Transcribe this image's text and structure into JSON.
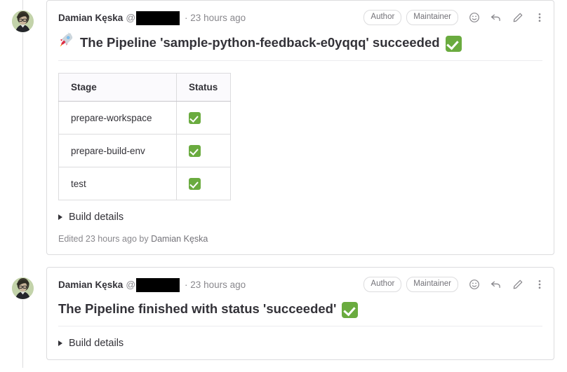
{
  "theme": {
    "accent_green": "#6aab3f",
    "border": "#dcdcde",
    "text": "#333238",
    "muted_text": "#89888d",
    "card_bg": "#ffffff",
    "table_header_bg": "#fbfafd"
  },
  "notes": [
    {
      "author": "Damian Kęska",
      "at_symbol": "@",
      "username_redacted": true,
      "separator": "·",
      "timestamp": "23 hours ago",
      "badges": [
        "Author",
        "Maintainer"
      ],
      "actions": [
        {
          "name": "add-reaction-icon",
          "label": "Add reaction"
        },
        {
          "name": "reply-icon",
          "label": "Reply to comment"
        },
        {
          "name": "edit-pencil-icon",
          "label": "Edit comment"
        },
        {
          "name": "more-actions-icon",
          "label": "More actions"
        }
      ],
      "title_prefix_emoji": "rocket",
      "title": "The Pipeline 'sample-python-feedback-e0yqqq' succeeded",
      "title_suffix_emoji": "white-check-mark",
      "table": {
        "columns": [
          "Stage",
          "Status"
        ],
        "rows": [
          {
            "stage": "prepare-workspace",
            "status": "white-check-mark"
          },
          {
            "stage": "prepare-build-env",
            "status": "white-check-mark"
          },
          {
            "stage": "test",
            "status": "white-check-mark"
          }
        ]
      },
      "build_details_label": "Build details",
      "edited": {
        "prefix": "Edited 23 hours ago by",
        "editor": "Damian Kęska"
      }
    },
    {
      "author": "Damian Kęska",
      "at_symbol": "@",
      "username_redacted": true,
      "separator": "·",
      "timestamp": "23 hours ago",
      "badges": [
        "Author",
        "Maintainer"
      ],
      "actions": [
        {
          "name": "add-reaction-icon",
          "label": "Add reaction"
        },
        {
          "name": "reply-icon",
          "label": "Reply to comment"
        },
        {
          "name": "edit-pencil-icon",
          "label": "Edit comment"
        },
        {
          "name": "more-actions-icon",
          "label": "More actions"
        }
      ],
      "title_prefix_emoji": null,
      "title": "The Pipeline finished with status 'succeeded'",
      "title_suffix_emoji": "white-check-mark",
      "table": null,
      "build_details_label": "Build details",
      "edited": null
    }
  ]
}
